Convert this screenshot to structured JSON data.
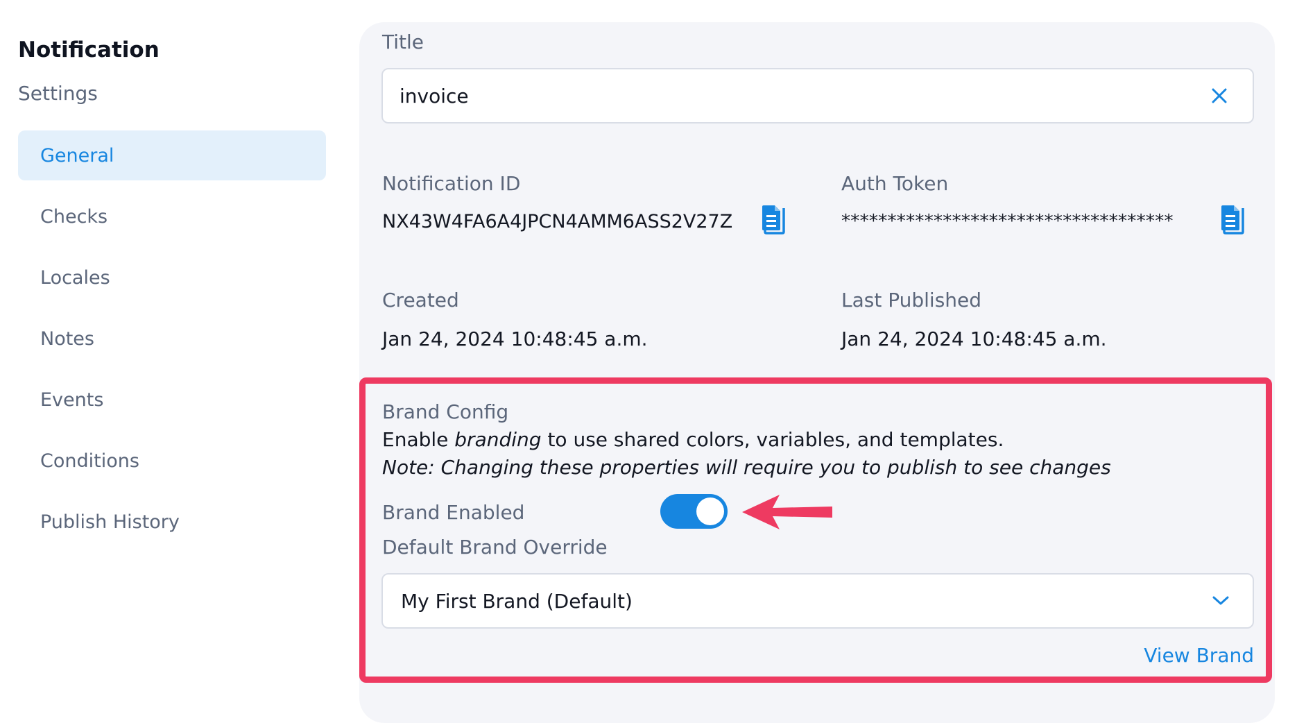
{
  "sidebar": {
    "title": "Notification",
    "subtitle": "Settings",
    "items": [
      {
        "label": "General",
        "active": true
      },
      {
        "label": "Checks"
      },
      {
        "label": "Locales"
      },
      {
        "label": "Notes"
      },
      {
        "label": "Events"
      },
      {
        "label": "Conditions"
      },
      {
        "label": "Publish History"
      }
    ]
  },
  "main": {
    "title_label": "Title",
    "title_value": "invoice",
    "notification_id_label": "Notification ID",
    "notification_id_value": "NX43W4FA6A4JPCN4AMM6ASS2V27Z",
    "auth_token_label": "Auth Token",
    "auth_token_value": "************************************",
    "created_label": "Created",
    "created_value": "Jan 24, 2024 10:48:45 a.m.",
    "last_published_label": "Last Published",
    "last_published_value": "Jan 24, 2024 10:48:45 a.m."
  },
  "brand": {
    "section_label": "Brand Config",
    "desc_prefix": "Enable ",
    "desc_emphasis": "branding",
    "desc_suffix": " to use shared colors, variables, and templates.",
    "note": "Note: Changing these properties will require you to publish to see changes",
    "enabled_label": "Brand Enabled",
    "enabled": true,
    "override_label": "Default Brand Override",
    "override_value": "My First Brand (Default)",
    "view_link": "View Brand"
  },
  "colors": {
    "accent": "#1786e0",
    "highlight": "#ee3a61",
    "panel_bg": "#f4f5f9",
    "active_nav_bg": "#e3f0fb"
  },
  "icons": {
    "clear": "close-icon",
    "copy": "copy-document-icon",
    "dropdown": "chevron-down-icon",
    "annotation": "arrow-left-icon"
  }
}
